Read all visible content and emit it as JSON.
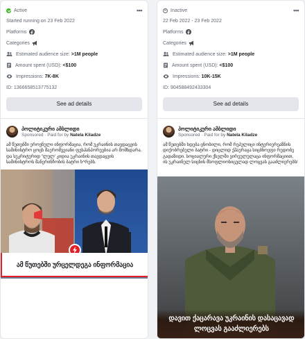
{
  "ads": [
    {
      "status": "Active",
      "status_type": "active",
      "date_line": "Started running on 23 Feb 2022",
      "platforms_label": "Platforms",
      "platform_icon": "facebook-icon",
      "categories_label": "Categories",
      "category_icon": "megaphone-icon",
      "audience_label": "Estimated audience size:",
      "audience_value": ">1M people",
      "spent_label": "Amount spent (USD):",
      "spent_value": "<$100",
      "impressions_label": "Impressions:",
      "impressions_value": "7K-8K",
      "id_line": "ID: 1366658513775132",
      "button_label": "See ad details",
      "page_name": "პოლიტიკური ამბლიდი",
      "sponsored_prefix": "Sponsored · Paid for by",
      "paid_by": "Natela Kiladze",
      "ad_text": "ამ წუთებში ეროვნული ინფორმაცია, რომ უკრაინის თავდაცვის სამინისტრო ცოცხ მაერომვეიანი ფესპანპორეებია არ მომხდარა. და სეკრიტურიდ \"ლულ' კიდია უკრაინის თავდაცვის სამინისტროს მანერინჩობის ბატრი ხ^რებს.",
      "creative_banner": "ამ წუთებში ურცელდეგა ინფორმაცია"
    },
    {
      "status": "Inactive",
      "status_type": "inactive",
      "date_line": "22 Feb 2022 - 23 Feb 2022",
      "platforms_label": "Platforms",
      "platform_icon": "facebook-icon",
      "categories_label": "Categories",
      "category_icon": "megaphone-icon",
      "audience_label": "Estimated audience size:",
      "audience_value": ">1M people",
      "spent_label": "Amount spent (USD):",
      "spent_value": "<$100",
      "impressions_label": "Impressions:",
      "impressions_value": "10K-15K",
      "id_line": "ID: 904588492433304",
      "button_label": "See ad details",
      "page_name": "პოლიტიკური ამბლიდი",
      "sponsored_prefix": "Sponsored · Paid for by",
      "paid_by": "Natela Kiladze",
      "ad_text": "ამ წუთებში ხდება ცნობილი, რომ რეპულიცი ინტერიერეაზნის დიქობრებული ბატრი - დიცლიდ ქჰაურაცა სიცბნოეფი რუდობე გადაზიდი. სოციალური ქსელში ვირეულულაცა ინფორმაციით, ის უკრაინულ სიცნის მსოფლიოსიცულად ლოცვას გააძლიერებს!",
      "creative_headline": "დავით ქაცარავა უკრაინის დასაცავად ლოცვას გააძლიერებს"
    }
  ]
}
